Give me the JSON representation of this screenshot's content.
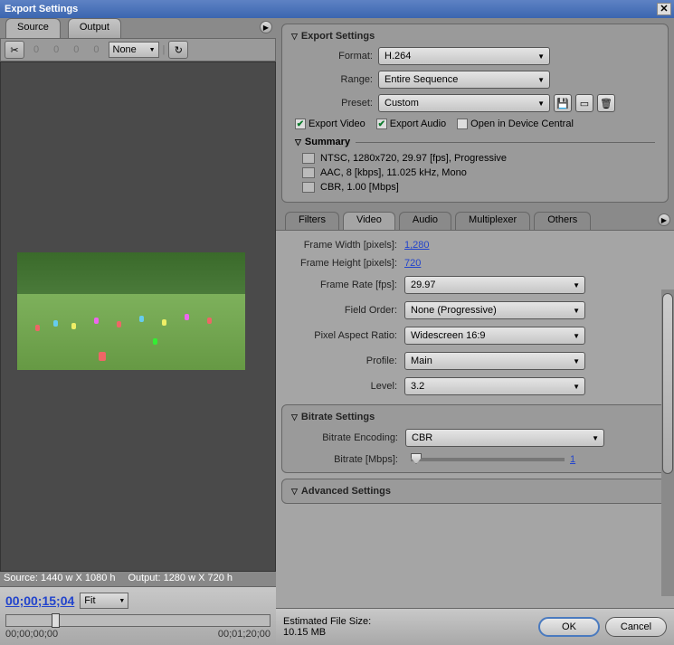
{
  "window": {
    "title": "Export Settings"
  },
  "tabs": {
    "source": "Source",
    "output": "Output"
  },
  "toolbar": {
    "none": "None"
  },
  "preview": {
    "source_info": "Source: 1440 w X 1080 h",
    "output_info": "Output: 1280 w X 720 h"
  },
  "time": {
    "current": "00;00;15;04",
    "fit": "Fit",
    "start": "00;00;00;00",
    "end": "00;01;20;00"
  },
  "export": {
    "title": "Export Settings",
    "format_label": "Format:",
    "format_value": "H.264",
    "range_label": "Range:",
    "range_value": "Entire Sequence",
    "preset_label": "Preset:",
    "preset_value": "Custom",
    "export_video": "Export Video",
    "export_audio": "Export Audio",
    "open_device": "Open in Device Central",
    "summary": "Summary",
    "sum1": "NTSC, 1280x720, 29.97 [fps], Progressive",
    "sum2": "AAC, 8 [kbps], 11.025 kHz, Mono",
    "sum3": "CBR, 1.00 [Mbps]"
  },
  "subtabs": {
    "filters": "Filters",
    "video": "Video",
    "audio": "Audio",
    "multiplexer": "Multiplexer",
    "others": "Others"
  },
  "video": {
    "width_label": "Frame Width [pixels]:",
    "width_value": "1,280",
    "height_label": "Frame Height [pixels]:",
    "height_value": "720",
    "rate_label": "Frame Rate [fps]:",
    "rate_value": "29.97",
    "field_label": "Field Order:",
    "field_value": "None (Progressive)",
    "par_label": "Pixel Aspect Ratio:",
    "par_value": "Widescreen 16:9",
    "profile_label": "Profile:",
    "profile_value": "Main",
    "level_label": "Level:",
    "level_value": "3.2"
  },
  "bitrate": {
    "title": "Bitrate Settings",
    "encoding_label": "Bitrate Encoding:",
    "encoding_value": "CBR",
    "rate_label": "Bitrate [Mbps]:",
    "rate_value": "1"
  },
  "advanced": {
    "title": "Advanced Settings"
  },
  "footer": {
    "est_label": "Estimated File Size:",
    "est_value": "10.15 MB",
    "ok": "OK",
    "cancel": "Cancel"
  }
}
